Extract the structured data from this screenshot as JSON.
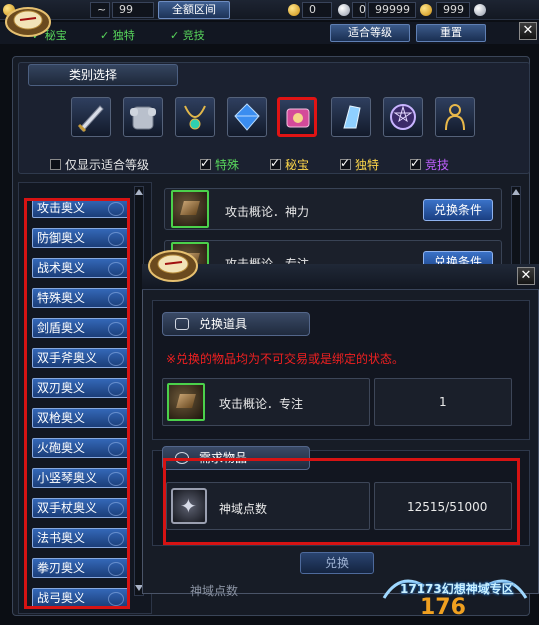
{
  "topbar": {
    "field_a": "~",
    "field_b": "99",
    "range_button": "全额区间",
    "gold_min": "0",
    "gold_sep": "~",
    "silver_min": "0",
    "silver_sep": "~",
    "silver_max": "99999",
    "gold_max": "999"
  },
  "row2": {
    "filters": [
      "秘宝",
      "独特",
      "竞技"
    ],
    "suitable_button": "适合等级",
    "reset_button": "重置"
  },
  "category": {
    "title": "类别选择",
    "tabs": [
      "sword-icon",
      "armor-icon",
      "necklace-icon",
      "gem-icon",
      "book-icon",
      "crystal-icon",
      "rune-icon",
      "silhouette-icon"
    ],
    "selected_tab": 4
  },
  "filters": {
    "only_suitable": "仅显示适合等级",
    "special": "特殊",
    "treasure": "秘宝",
    "unique": "独特",
    "competitive": "竞技"
  },
  "sidebar": {
    "items": [
      "攻击奥义",
      "防御奥义",
      "战术奥义",
      "特殊奥义",
      "剑盾奥义",
      "双手斧奥义",
      "双刃奥义",
      "双枪奥义",
      "火砲奥义",
      "小竖琴奥义",
      "双手杖奥义",
      "法书奥义",
      "拳刃奥义",
      "战弓奥义"
    ]
  },
  "list": {
    "rows": [
      {
        "name": "攻击概论．神力",
        "button": "兑换条件"
      },
      {
        "name": "攻击概论．专注",
        "button": "兑换条件"
      }
    ]
  },
  "dialog": {
    "exchange_title": "兑换道具",
    "warning": "※兑换的物品均为不可交易或是绑定的状态。",
    "item_name": "攻击概论．专注",
    "item_count": "1",
    "required_title": "需求物品",
    "req_name": "神域点数",
    "req_count": "12515/51000",
    "confirm_button": "兑换",
    "hidden_label": "神域点数"
  },
  "watermark": {
    "text": "17173幻想神域专区"
  },
  "colors": {
    "accent_red": "#d61313",
    "check_green": "#58d65c",
    "special_text": "#58d65c",
    "treasure_text": "#ffd84a",
    "unique_text": "#ffd84a",
    "competitive_text": "#c060ff",
    "warning": "#f02020"
  }
}
